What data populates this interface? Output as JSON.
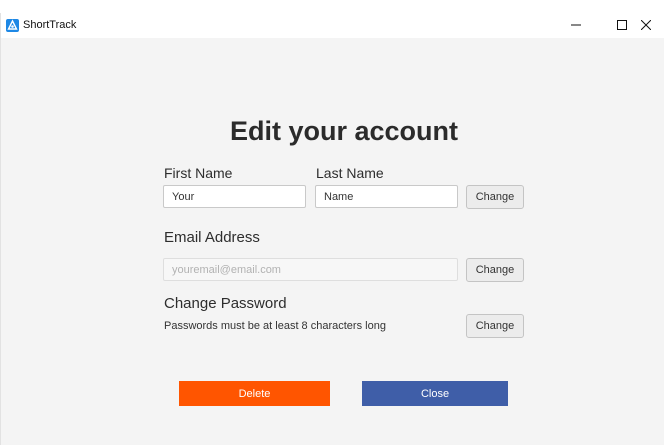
{
  "window": {
    "title": "ShortTrack",
    "icon": "app-logo-icon",
    "controls": {
      "minimize_icon": "minimize-icon",
      "maximize_icon": "maximize-icon",
      "close_icon": "close-icon"
    }
  },
  "page": {
    "heading": "Edit your account"
  },
  "name_section": {
    "first_label": "First Name",
    "first_value": "Your",
    "last_label": "Last Name",
    "last_value": "Name",
    "change_label": "Change"
  },
  "email_section": {
    "label": "Email Address",
    "placeholder": "youremail@email.com",
    "change_label": "Change"
  },
  "password_section": {
    "label": "Change Password",
    "help_text": "Passwords must be at least 8 characters long",
    "change_label": "Change"
  },
  "actions": {
    "delete_label": "Delete",
    "close_label": "Close"
  },
  "colors": {
    "delete": "#ff5500",
    "close": "#3f5ea8",
    "app_icon": "#1e88e5"
  }
}
